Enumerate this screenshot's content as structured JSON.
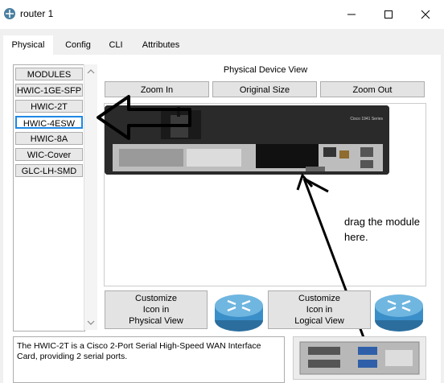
{
  "window": {
    "title": "router 1"
  },
  "tabs": [
    {
      "label": "Physical",
      "active": true
    },
    {
      "label": "Config"
    },
    {
      "label": "CLI"
    },
    {
      "label": "Attributes"
    }
  ],
  "modules": {
    "header": "MODULES",
    "items": [
      "HWIC-1GE-SFP",
      "HWIC-2T",
      "HWIC-4ESW",
      "HWIC-8A",
      "WIC-Cover",
      "GLC-LH-SMD"
    ],
    "selected_index": 2
  },
  "device_view": {
    "title": "Physical Device View",
    "zoom_in": "Zoom In",
    "original_size": "Original Size",
    "zoom_out": "Zoom Out",
    "router_model": "Cisco 1941 Series"
  },
  "customize": {
    "physical": [
      "Customize",
      "Icon in",
      "Physical View"
    ],
    "logical": [
      "Customize",
      "Icon in",
      "Logical View"
    ]
  },
  "description": "The HWIC-2T is a Cisco 2-Port Serial High-Speed WAN Interface Card, providing 2 serial ports.",
  "annotation": {
    "line1": "drag the module",
    "line2": "here."
  },
  "colors": {
    "accent": "#1e88e5",
    "router": "#2a2a2a",
    "router_icon": "#3a8fc9"
  }
}
